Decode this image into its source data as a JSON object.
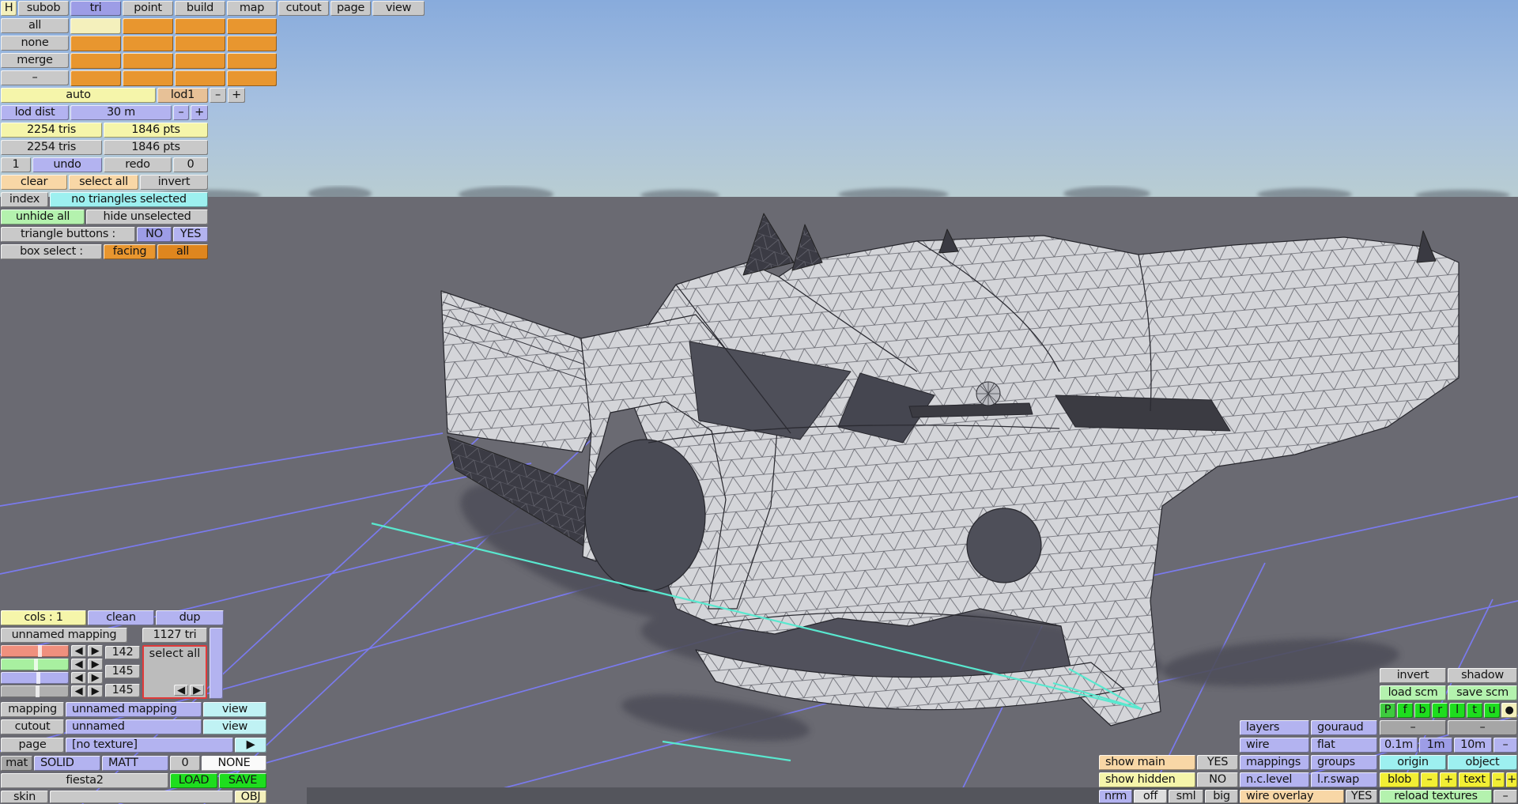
{
  "menu": {
    "h": "H",
    "subob": "subob",
    "tri": "tri",
    "point": "point",
    "build": "build",
    "map": "map",
    "cutout": "cutout",
    "page": "page",
    "view": "view"
  },
  "matrix": {
    "all": "all",
    "none": "none",
    "merge": "merge",
    "dash": "–"
  },
  "lod": {
    "auto": "auto",
    "lod1": "lod1",
    "dist_label": "lod dist",
    "dist_value": "30 m"
  },
  "common": {
    "minus": "–",
    "plus": "+"
  },
  "stats": {
    "tris": "2254 tris",
    "pts": "1846 pts"
  },
  "history": {
    "undo_count": "1",
    "undo": "undo",
    "redo": "redo",
    "redo_count": "0"
  },
  "sel": {
    "clear": "clear",
    "select_all": "select all",
    "invert": "invert",
    "index": "index",
    "status": "no triangles selected",
    "unhide": "unhide all",
    "hide": "hide unselected",
    "tb_label": "triangle buttons :",
    "no": "NO",
    "yes": "YES",
    "bs_label": "box select :",
    "facing": "facing",
    "all": "all"
  },
  "colsel": {
    "cols": "cols : 1",
    "clean": "clean",
    "dup": "dup",
    "name": "unnamed mapping",
    "tris": "1127 tri",
    "v1": "142",
    "v2": "145",
    "v3": "145",
    "select_all": "select all"
  },
  "obj": {
    "mapping_label": "mapping",
    "mapping_value": "unnamed mapping",
    "view": "view",
    "cutout_label": "cutout",
    "cutout_value": "unnamed",
    "page_label": "page",
    "page_value": "[no texture]",
    "mat_label": "mat",
    "solid": "SOLID",
    "matt": "MATT",
    "zero": "0",
    "none": "NONE",
    "file": "fiesta2",
    "load": "LOAD",
    "save": "SAVE",
    "skin": "skin",
    "objbtn": "OBJ"
  },
  "rp": {
    "invert": "invert",
    "shadow": "shadow",
    "load_scm": "load scm",
    "save_scm": "save scm",
    "views": [
      "P",
      "f",
      "b",
      "r",
      "l",
      "t",
      "u"
    ],
    "layers": "layers",
    "gouraud": "gouraud",
    "wire": "wire",
    "flat": "flat",
    "m01": "0.1m",
    "m1": "1m",
    "m10": "10m",
    "show_main": "show main",
    "yes": "YES",
    "mappings": "mappings",
    "groups": "groups",
    "origin": "origin",
    "object": "object",
    "show_hidden": "show hidden",
    "no": "NO",
    "nclevel": "n.c.level",
    "lrswap": "l.r.swap",
    "blob": "blob",
    "text": "text",
    "nrm": "nrm",
    "off": "off",
    "sml": "sml",
    "big": "big",
    "wire_overlay": "wire overlay",
    "reload": "reload textures"
  },
  "icons": {
    "left": "◀",
    "right": "▶",
    "play": "▶",
    "dot": "●"
  },
  "viewport_colors": {
    "sky_top": "#88abdc",
    "sky_horizon": "#b9cdd2",
    "ground": "#6a6a72",
    "grid": "#7b7bf5",
    "axis": "#59e8cf",
    "wire_body": "#d4d5d9",
    "shadow": "#4f505a"
  }
}
